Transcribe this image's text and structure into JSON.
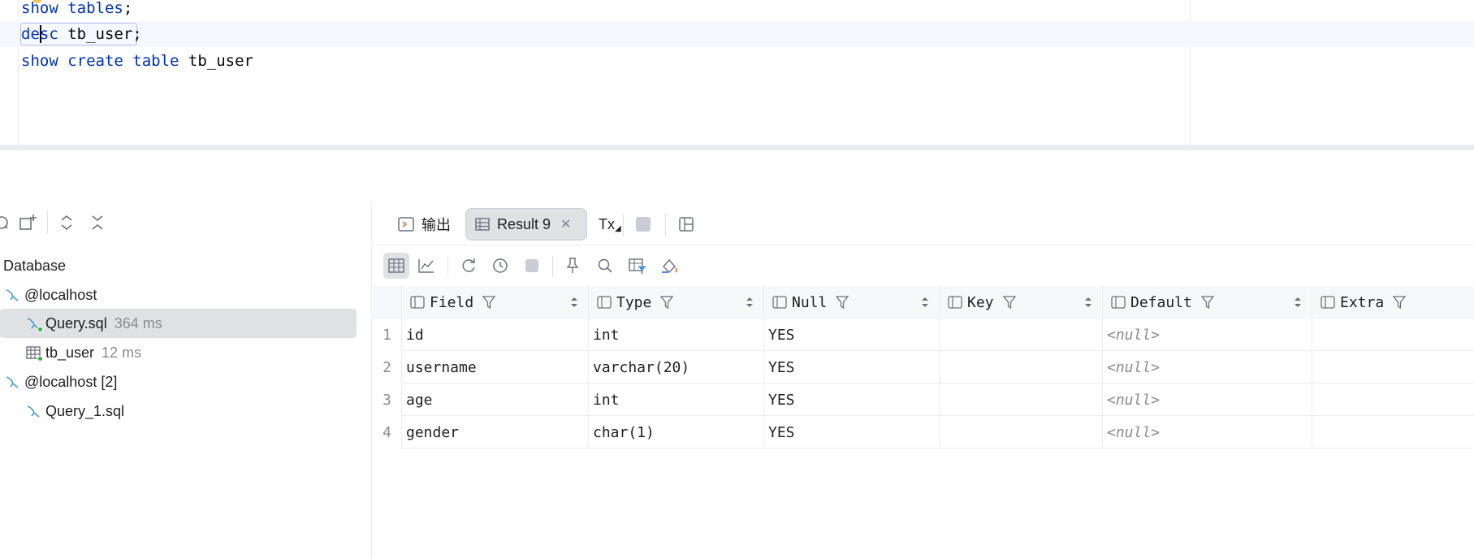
{
  "editor": {
    "lines": [
      {
        "kw": "show tables",
        "rest": ";"
      },
      {
        "kw": "desc",
        "rest": " tb_user;"
      },
      {
        "kw": "show create table",
        "rest": " tb_user"
      }
    ]
  },
  "services": {
    "root_label": "Database",
    "items": [
      {
        "label": "@localhost",
        "time": ""
      },
      {
        "label": "Query.sql",
        "time": "364 ms"
      },
      {
        "label": "tb_user",
        "time": "12 ms"
      },
      {
        "label": "@localhost [2]",
        "time": ""
      },
      {
        "label": "Query_1.sql",
        "time": ""
      }
    ]
  },
  "results": {
    "tabs": {
      "output": "输出",
      "result": "Result 9",
      "tx": "Tx"
    },
    "columns": [
      "Field",
      "Type",
      "Null",
      "Key",
      "Default",
      "Extra"
    ],
    "rows": [
      {
        "num": "1",
        "field": "id",
        "type": "int",
        "null": "YES",
        "key": "",
        "default": "<null>",
        "extra": ""
      },
      {
        "num": "2",
        "field": "username",
        "type": "varchar(20)",
        "null": "YES",
        "key": "",
        "default": "<null>",
        "extra": ""
      },
      {
        "num": "3",
        "field": "age",
        "type": "int",
        "null": "YES",
        "key": "",
        "default": "<null>",
        "extra": ""
      },
      {
        "num": "4",
        "field": "gender",
        "type": "char(1)",
        "null": "YES",
        "key": "",
        "default": "<null>",
        "extra": ""
      }
    ]
  },
  "colors": {
    "keyword": "#0033b3",
    "selection": "#dfe1e5",
    "running_dot": "#3dab40"
  }
}
